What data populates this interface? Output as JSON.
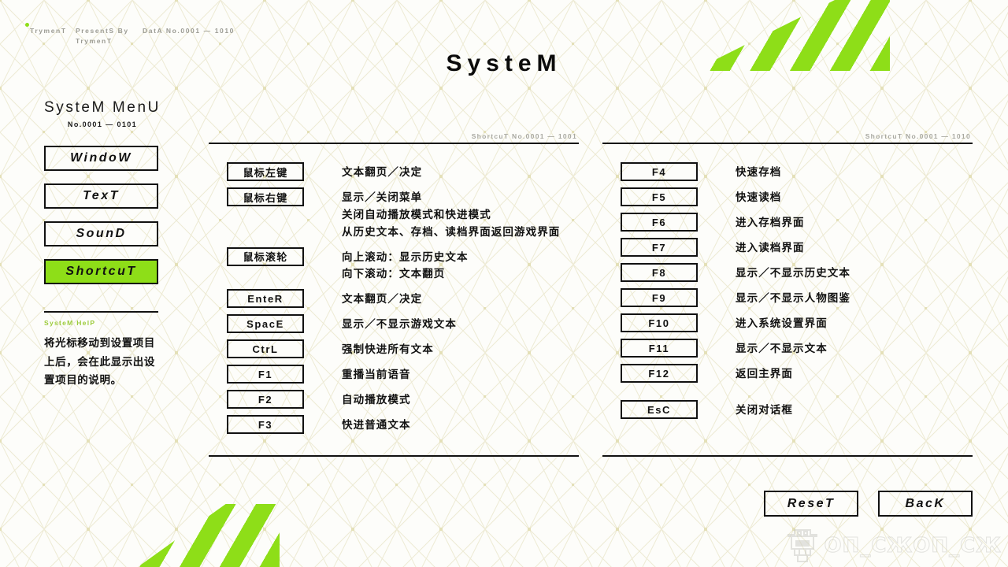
{
  "meta": {
    "brand": "TrymenT",
    "presents": "PresentS By\nTrymenT",
    "presents_line1": "PresentS By",
    "presents_line2": "TrymenT",
    "data_no": "DatA No.0001 — 1010"
  },
  "header": {
    "title": "SysteM"
  },
  "sidebar": {
    "title": "SysteM MenU",
    "subtitle": "No.0001 — 0101",
    "items": [
      {
        "label": "WindoW",
        "active": false
      },
      {
        "label": "TexT",
        "active": false
      },
      {
        "label": "SounD",
        "active": false
      },
      {
        "label": "ShortcuT",
        "active": true
      }
    ],
    "help": {
      "label": "SysteM HelP",
      "text": "将光标移动到设置项目上后，会在此显示出设置项目的说明。"
    }
  },
  "columns": [
    {
      "header": "ShortcuT No.0001 — 1001",
      "rows": [
        {
          "key": "鼠标左键",
          "cjk_key": true,
          "gap": false,
          "desc": [
            "文本翻页／决定"
          ]
        },
        {
          "key": "鼠标右键",
          "cjk_key": true,
          "gap": false,
          "desc": [
            "显示／关闭菜单",
            "关闭自动播放模式和快进模式",
            "从历史文本、存档、读档界面返回游戏界面"
          ]
        },
        {
          "key": "鼠标滚轮",
          "cjk_key": true,
          "gap": false,
          "desc": [
            "向上滚动：显示历史文本",
            "向下滚动：文本翻页"
          ]
        },
        {
          "key": "EnteR",
          "cjk_key": false,
          "gap": false,
          "desc": [
            "文本翻页／决定"
          ]
        },
        {
          "key": "SpacE",
          "cjk_key": false,
          "gap": false,
          "desc": [
            "显示／不显示游戏文本"
          ]
        },
        {
          "key": "CtrL",
          "cjk_key": false,
          "gap": false,
          "desc": [
            "强制快进所有文本"
          ]
        },
        {
          "key": "F1",
          "cjk_key": false,
          "gap": false,
          "desc": [
            "重播当前语音"
          ]
        },
        {
          "key": "F2",
          "cjk_key": false,
          "gap": false,
          "desc": [
            "自动播放模式"
          ]
        },
        {
          "key": "F3",
          "cjk_key": false,
          "gap": false,
          "desc": [
            "快进普通文本"
          ]
        }
      ]
    },
    {
      "header": "ShortcuT No.0001 — 1010",
      "rows": [
        {
          "key": "F4",
          "cjk_key": false,
          "gap": false,
          "desc": [
            "快速存档"
          ]
        },
        {
          "key": "F5",
          "cjk_key": false,
          "gap": false,
          "desc": [
            "快速读档"
          ]
        },
        {
          "key": "F6",
          "cjk_key": false,
          "gap": false,
          "desc": [
            "进入存档界面"
          ]
        },
        {
          "key": "F7",
          "cjk_key": false,
          "gap": false,
          "desc": [
            "进入读档界面"
          ]
        },
        {
          "key": "F8",
          "cjk_key": false,
          "gap": false,
          "desc": [
            "显示／不显示历史文本"
          ]
        },
        {
          "key": "F9",
          "cjk_key": false,
          "gap": false,
          "desc": [
            "显示／不显示人物图鉴"
          ]
        },
        {
          "key": "F10",
          "cjk_key": false,
          "gap": false,
          "desc": [
            "进入系统设置界面"
          ]
        },
        {
          "key": "F11",
          "cjk_key": false,
          "gap": false,
          "desc": [
            "显示／不显示文本"
          ]
        },
        {
          "key": "F12",
          "cjk_key": false,
          "gap": false,
          "desc": [
            "返回主界面"
          ]
        },
        {
          "key": "EsC",
          "cjk_key": false,
          "gap": true,
          "desc": [
            "关闭对话框"
          ]
        }
      ]
    }
  ],
  "actions": [
    {
      "label": "ReseT"
    },
    {
      "label": "BacK"
    }
  ],
  "watermark": {
    "icon": "pixel-robot-icon",
    "text": "OΠ_CЖOΠ_CЖ"
  },
  "colors": {
    "accent_green": "#8ede18",
    "help_label_green": "#9ccb3b",
    "ink": "#111111",
    "muted": "#a8a8a0",
    "background": "#fdfdfa",
    "pattern": "#e9e7cf"
  }
}
